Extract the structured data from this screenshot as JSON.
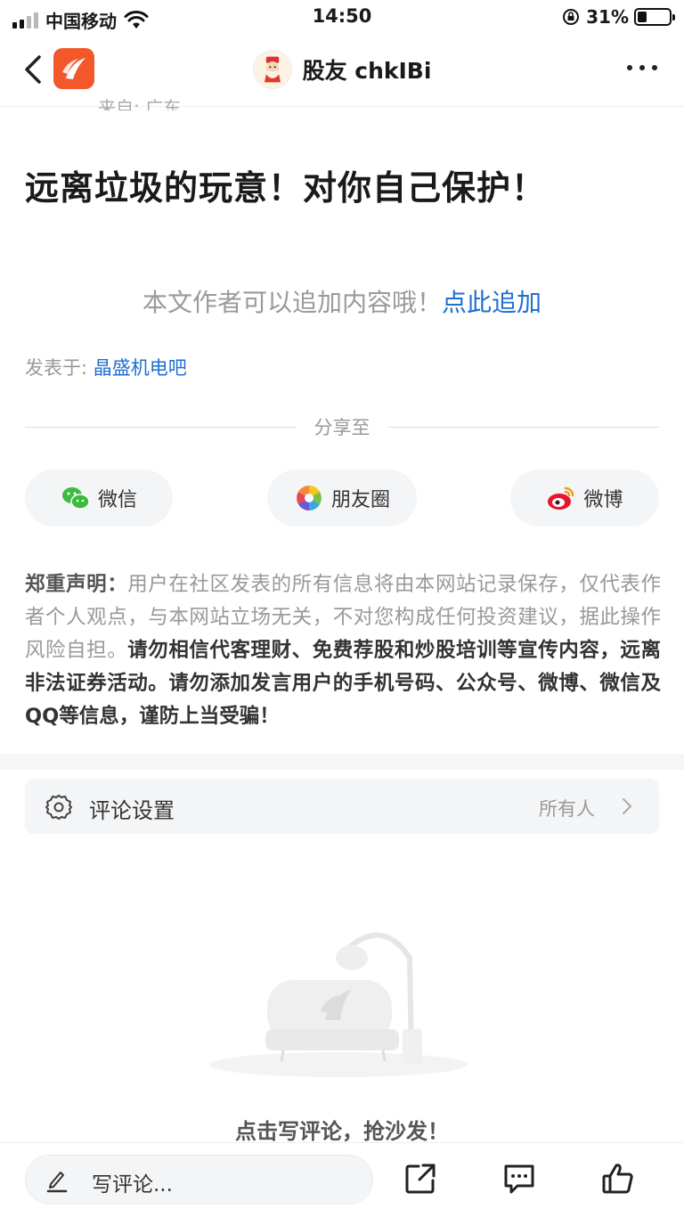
{
  "status_bar": {
    "carrier": "中国移动",
    "time": "14:50",
    "battery": "31%",
    "battery_level": 0.31
  },
  "nav": {
    "title": "股友 chkIBi"
  },
  "post": {
    "source_partial": "来自: 广东",
    "title": "远离垃圾的玩意！对你自己保护！",
    "append_prompt": "本文作者可以追加内容哦！",
    "append_link": "点此追加",
    "posted_in_label": "发表于:",
    "posted_in_bar": "晶盛机电吧"
  },
  "share": {
    "label": "分享至",
    "buttons": [
      {
        "label": "微信",
        "icon": "wechat-icon"
      },
      {
        "label": "朋友圈",
        "icon": "moments-icon"
      },
      {
        "label": "微博",
        "icon": "weibo-icon"
      }
    ]
  },
  "disclaimer": {
    "heading": "郑重声明：",
    "normal": "用户在社区发表的所有信息将由本网站记录保存，仅代表作者个人观点，与本网站立场无关，不对您构成任何投资建议，据此操作风险自担。",
    "strong": "请勿相信代客理财、免费荐股和炒股培训等宣传内容，远离非法证券活动。请勿添加发言用户的手机号码、公众号、微博、微信及QQ等信息，谨防上当受骗！"
  },
  "comments": {
    "settings_label": "评论设置",
    "settings_value": "所有人",
    "empty_text": "点击写评论，抢沙发！"
  },
  "bottom_bar": {
    "write_placeholder": "写评论...",
    "icons": [
      "share-out-icon",
      "comment-icon",
      "like-icon"
    ]
  },
  "colors": {
    "brand": "#f2582a",
    "link": "#1f6fd1",
    "muted": "#999999"
  }
}
